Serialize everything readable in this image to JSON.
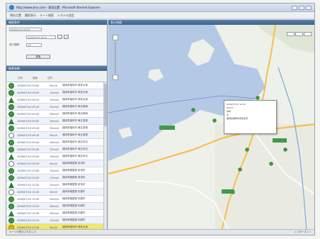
{
  "window": {
    "title": "http://www.alnx.com - 車両位置 - Microsoft Internet Explorer"
  },
  "menu": {
    "items": [
      "現在位置",
      "履歴表示",
      "ルート検索",
      "システム設定"
    ]
  },
  "left": {
    "search_title": "検索条件",
    "list_title": "検索結果",
    "date_from": "2009/07/10 09:00",
    "date_to": "2009/07/10 18:00",
    "interval_label": "表示間隔",
    "interval_value": "5分",
    "search_button": "検索",
    "columns": [
      "日時",
      "速度",
      "住所"
    ],
    "rows": [
      {
        "time": "2009/07/10 09:00",
        "speed": "0km/h",
        "addr": "福岡県福岡市",
        "area": "博多区東"
      },
      {
        "time": "2009/07/10 09:05",
        "speed": "12km/h",
        "addr": "福岡県福岡市",
        "area": "博多区東"
      },
      {
        "time": "2009/07/10 09:10",
        "speed": "25km/h",
        "addr": "福岡県福岡市",
        "area": "博多区東"
      },
      {
        "time": "2009/07/10 09:15",
        "speed": "31km/h",
        "addr": "福岡県福岡市",
        "area": "東区箱崎"
      },
      {
        "time": "2009/07/10 09:20",
        "speed": "28km/h",
        "addr": "福岡県福岡市",
        "area": "東区箱崎"
      },
      {
        "time": "2009/07/10 09:25",
        "speed": "40km/h",
        "addr": "福岡県福岡市",
        "area": "東区香椎"
      },
      {
        "time": "2009/07/10 09:30",
        "speed": "35km/h",
        "addr": "福岡県福岡市",
        "area": "東区香椎"
      },
      {
        "time": "2009/07/10 09:35",
        "speed": "0km/h",
        "addr": "福岡県福岡市",
        "area": "東区香椎"
      },
      {
        "time": "2009/07/10 09:40",
        "speed": "18km/h",
        "addr": "福岡県福岡市",
        "area": "東区和白"
      },
      {
        "time": "2009/07/10 09:45",
        "speed": "22km/h",
        "addr": "福岡県福岡市",
        "area": "東区和白"
      },
      {
        "time": "2009/07/10 09:50",
        "speed": "30km/h",
        "addr": "福岡県福岡市",
        "area": "東区和白"
      },
      {
        "time": "2009/07/10 09:55",
        "speed": "0km/h",
        "addr": "福岡県糟屋郡",
        "area": "新宮町"
      },
      {
        "time": "2009/07/10 10:00",
        "speed": "15km/h",
        "addr": "福岡県糟屋郡",
        "area": "新宮町"
      },
      {
        "time": "2009/07/10 10:05",
        "speed": "27km/h",
        "addr": "福岡県糟屋郡",
        "area": "新宮町"
      },
      {
        "time": "2009/07/10 10:10",
        "speed": "33km/h",
        "addr": "福岡県糟屋郡",
        "area": "新宮町"
      },
      {
        "time": "2009/07/10 10:15",
        "speed": "0km/h",
        "addr": "福岡県糟屋郡",
        "area": "粕屋町"
      },
      {
        "time": "2009/07/10 10:20",
        "speed": "20km/h",
        "addr": "福岡県糟屋郡",
        "area": "粕屋町"
      },
      {
        "time": "2009/07/10 10:25",
        "speed": "26km/h",
        "addr": "福岡県糟屋郡",
        "area": "粕屋町"
      },
      {
        "time": "2009/07/10 10:30",
        "speed": "38km/h",
        "addr": "福岡県糟屋郡",
        "area": "粕屋町"
      },
      {
        "time": "2009/07/10 10:35",
        "speed": "12km/h",
        "addr": "福岡県糟屋郡",
        "area": "粕屋町"
      },
      {
        "time": "2009/07/10 10:40",
        "speed": "0km/h",
        "addr": "福岡県福岡市",
        "area": "博多区東"
      }
    ]
  },
  "map": {
    "title": "表示地図",
    "popup": {
      "time": "2009/07/10 10:40",
      "speed": "0km/h",
      "status": "停車",
      "dir": "北",
      "addr": "福岡県福岡市博多区東"
    }
  },
  "status": {
    "left": "ページが表示されました",
    "right": "インターネット"
  },
  "colors": {
    "sea": "#b4c9e6",
    "land": "#eef0ea",
    "marker": "#3c9b3c",
    "selected_row": "#f2e769"
  }
}
